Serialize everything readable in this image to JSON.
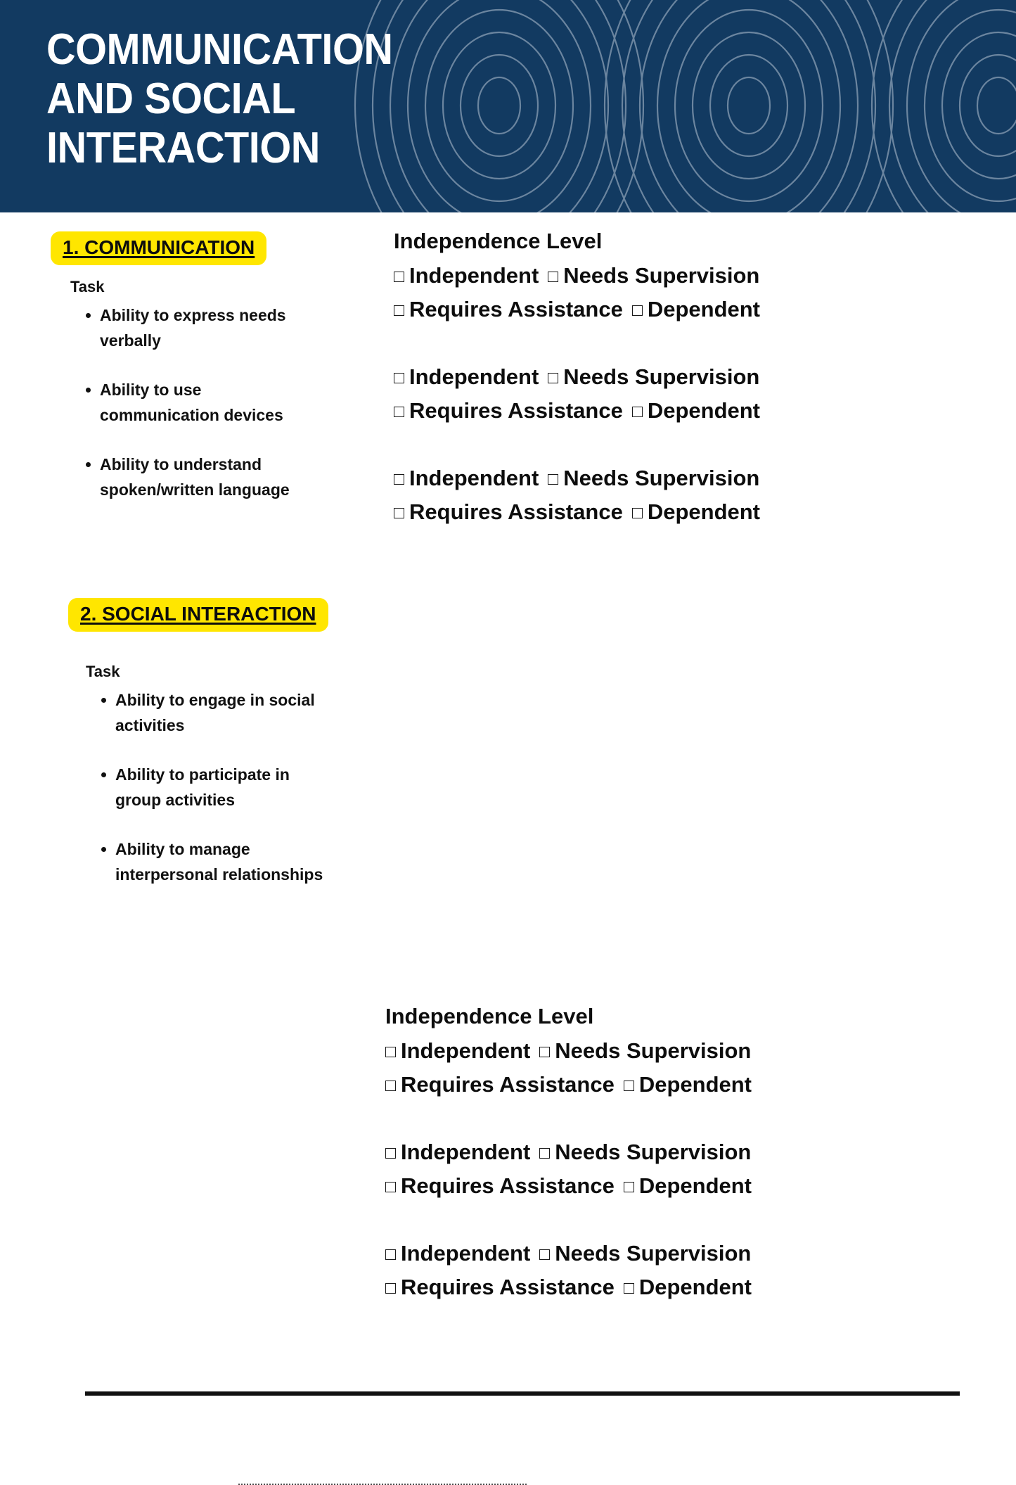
{
  "header": {
    "title": "COMMUNICATION\nAND SOCIAL\nINTERACTION",
    "background_color": "#123a61",
    "pattern_color": "#8ea2b8",
    "text_color": "#ffffff"
  },
  "theme": {
    "highlight_color": "#ffe600",
    "text_color": "#111111",
    "page_background": "#ffffff"
  },
  "sections": [
    {
      "heading": "1. COMMUNICATION",
      "task_label": "Task",
      "tasks": [
        "Ability to express needs verbally",
        "Ability to use communication devices",
        "Ability to understand spoken/written language"
      ],
      "level_title": "Independence Level",
      "level_groups": [
        {
          "row_a": [
            "Independent",
            "Needs Supervision"
          ],
          "row_b": [
            "Requires Assistance",
            "Dependent"
          ]
        },
        {
          "row_a": [
            "Independent",
            "Needs Supervision"
          ],
          "row_b": [
            "Requires Assistance",
            "Dependent"
          ]
        },
        {
          "row_a": [
            "Independent",
            "Needs Supervision"
          ],
          "row_b": [
            "Requires Assistance",
            "Dependent"
          ]
        }
      ]
    },
    {
      "heading": "2. SOCIAL INTERACTION",
      "task_label": "Task",
      "tasks": [
        "Ability to engage in social activities",
        "Ability to participate in group activities",
        "Ability to manage interpersonal relationships"
      ],
      "level_title": "Independence Level",
      "level_groups": [
        {
          "row_a": [
            "Independent",
            "Needs Supervision"
          ],
          "row_b": [
            "Requires Assistance",
            "Dependent"
          ]
        },
        {
          "row_a": [
            "Independent",
            "Needs Supervision"
          ],
          "row_b": [
            "Requires Assistance",
            "Dependent"
          ]
        },
        {
          "row_a": [
            "Independent",
            "Needs Supervision"
          ],
          "row_b": [
            "Requires Assistance",
            "Dependent"
          ]
        }
      ]
    }
  ],
  "section_1": {
    "heading": "1. COMMUNICATION",
    "task_label": "Task",
    "task_0": "Ability to express needs verbally",
    "task_1": "Ability to use communication devices",
    "task_2": "Ability to understand spoken/written language",
    "level_title": "Independence Level"
  },
  "section_2": {
    "heading": "2. SOCIAL INTERACTION",
    "task_label": "Task",
    "task_0": "Ability to engage in social activities",
    "task_1": "Ability to participate in group activities",
    "task_2": "Ability to manage interpersonal relationships",
    "level_title": "Independence Level"
  },
  "options": {
    "independent": "Independent",
    "needs_supervision": "Needs Supervision",
    "requires_assistance": "Requires Assistance",
    "dependent": "Dependent",
    "checkbox_glyph": "checkbox-empty"
  },
  "footer": {
    "rule": "horizontal-rule",
    "dotted_rule": "dotted-divider"
  }
}
